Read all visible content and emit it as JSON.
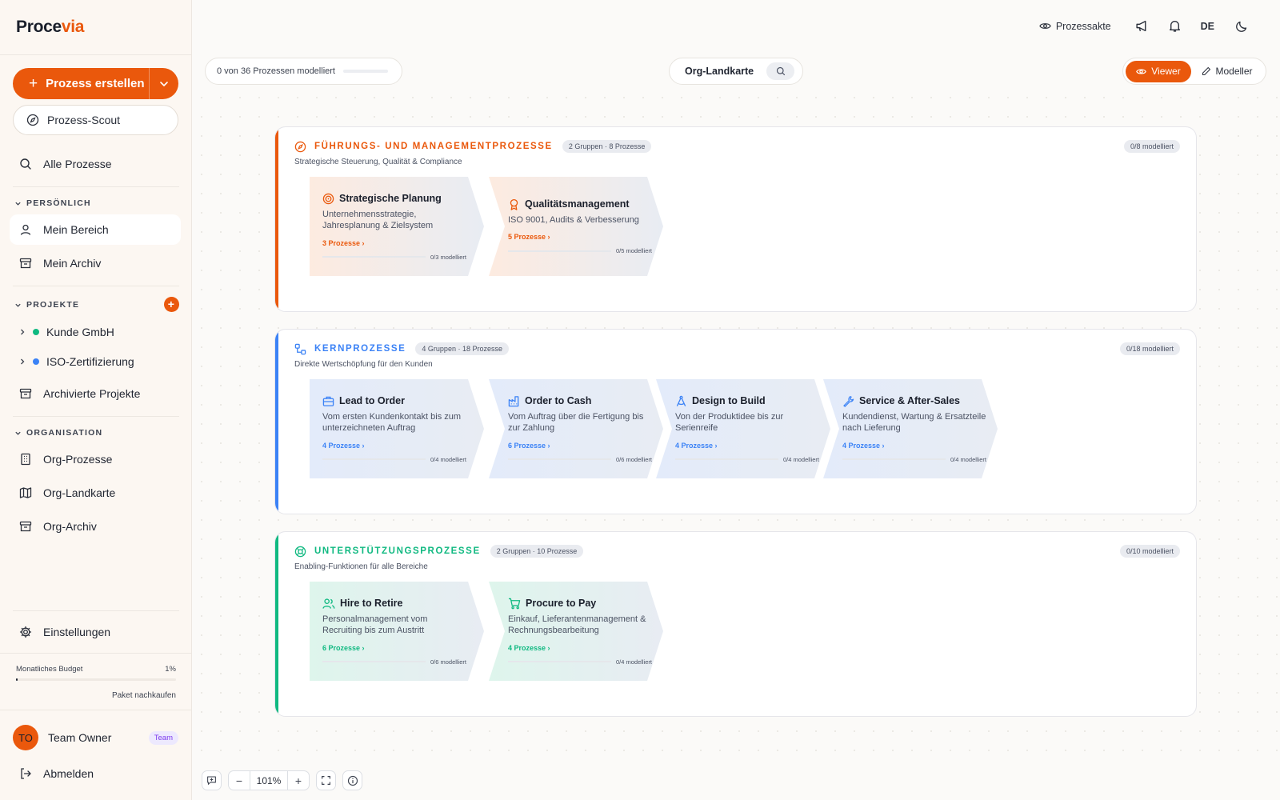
{
  "app": {
    "logo_main": "Proce",
    "logo_accent": "via",
    "brand_color": "#ea580c"
  },
  "sidebar": {
    "create_label": "Prozess erstellen",
    "scout_label": "Prozess-Scout",
    "all_processes": "Alle Prozesse",
    "personal_header": "PERSÖNLICH",
    "my_area": "Mein Bereich",
    "my_archive": "Mein Archiv",
    "projects_header": "PROJEKTE",
    "projects": [
      {
        "label": "Kunde GmbH",
        "color": "#10b981"
      },
      {
        "label": "ISO-Zertifizierung",
        "color": "#3b82f6"
      }
    ],
    "archived_projects": "Archivierte Projekte",
    "org_header": "ORGANISATION",
    "org_processes": "Org-Prozesse",
    "org_map": "Org-Landkarte",
    "org_archive": "Org-Archiv",
    "settings": "Einstellungen",
    "budget_label": "Monatliches Budget",
    "budget_value": "1%",
    "budget_fraction": 0.01,
    "buy_package": "Paket nachkaufen",
    "user_initials": "TO",
    "user_name": "Team Owner",
    "user_badge": "Team",
    "logout": "Abmelden"
  },
  "topbar": {
    "process_file": "Prozessakte",
    "language": "DE",
    "progress_text": "0 von 36 Prozessen modelliert",
    "map_title": "Org-Landkarte",
    "viewer": "Viewer",
    "modeller": "Modeller"
  },
  "sections": [
    {
      "title": "FÜHRUNGS- UND MANAGEMENTPROZESSE",
      "chip": "2 Gruppen · 8 Prozesse",
      "subtitle": "Strategische Steuerung, Qualität & Compliance",
      "count": "0/8 modelliert",
      "color": "#ea580c",
      "icon": "compass-icon",
      "cards": [
        {
          "title": "Strategische Planung",
          "desc": "Unternehmensstrategie, Jahresplanung & Zielsystem",
          "link": "3 Prozesse ›",
          "progress": "0/3 modelliert",
          "icon": "target-icon"
        },
        {
          "title": "Qualitätsmanagement",
          "desc": "ISO 9001, Audits & Verbesserung",
          "link": "5 Prozesse ›",
          "progress": "0/5 modelliert",
          "icon": "award-icon"
        }
      ]
    },
    {
      "title": "KERNPROZESSE",
      "chip": "4 Gruppen · 18 Prozesse",
      "subtitle": "Direkte Wertschöpfung für den Kunden",
      "count": "0/18 modelliert",
      "color": "#3b82f6",
      "icon": "workflow-icon",
      "cards": [
        {
          "title": "Lead to Order",
          "desc": "Vom ersten Kundenkontakt bis zum unterzeichneten Auftrag",
          "link": "4 Prozesse ›",
          "progress": "0/4 modelliert",
          "icon": "briefcase-icon"
        },
        {
          "title": "Order to Cash",
          "desc": "Vom Auftrag über die Fertigung bis zur Zahlung",
          "link": "6 Prozesse ›",
          "progress": "0/6 modelliert",
          "icon": "factory-icon"
        },
        {
          "title": "Design to Build",
          "desc": "Von der Produktidee bis zur Serienreife",
          "link": "4 Prozesse ›",
          "progress": "0/4 modelliert",
          "icon": "compass-drafting-icon"
        },
        {
          "title": "Service & After-Sales",
          "desc": "Kundendienst, Wartung & Ersatzteile nach Lieferung",
          "link": "4 Prozesse ›",
          "progress": "0/4 modelliert",
          "icon": "wrench-icon"
        }
      ]
    },
    {
      "title": "UNTERSTÜTZUNGSPROZESSE",
      "chip": "2 Gruppen · 10 Prozesse",
      "subtitle": "Enabling-Funktionen für alle Bereiche",
      "count": "0/10 modelliert",
      "color": "#10b981",
      "icon": "lifebuoy-icon",
      "cards": [
        {
          "title": "Hire to Retire",
          "desc": "Personalmanagement vom Recruiting bis zum Austritt",
          "link": "6 Prozesse ›",
          "progress": "0/6 modelliert",
          "icon": "users-icon"
        },
        {
          "title": "Procure to Pay",
          "desc": "Einkauf, Lieferantenmanagement & Rechnungsbearbeitung",
          "link": "4 Prozesse ›",
          "progress": "0/4 modelliert",
          "icon": "cart-icon"
        }
      ]
    }
  ],
  "zoom": {
    "value": "101%"
  }
}
